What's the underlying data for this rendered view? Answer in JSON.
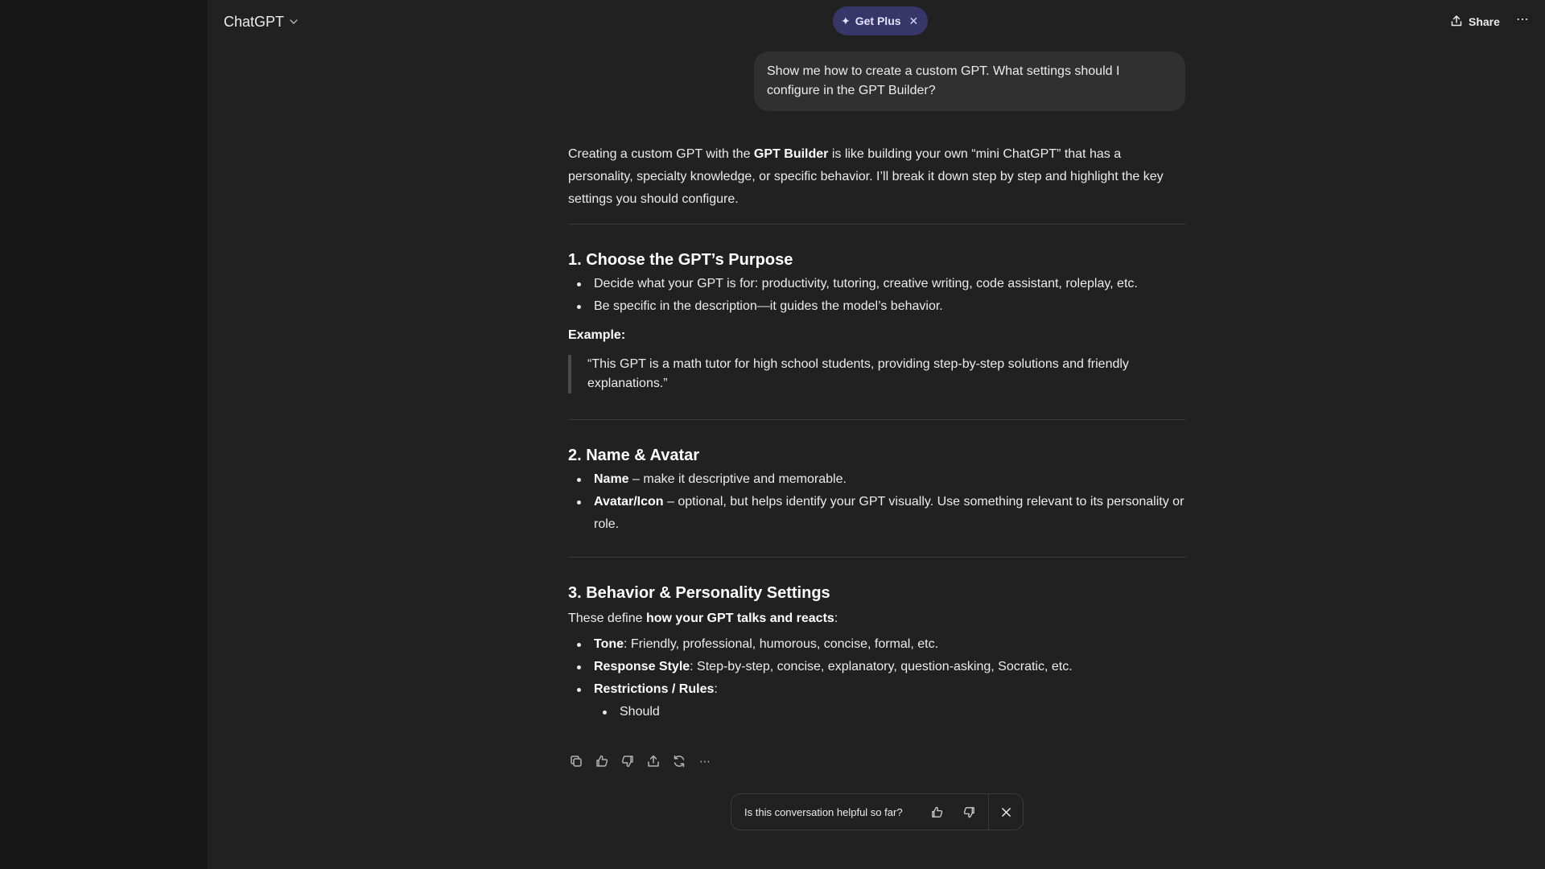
{
  "header": {
    "model_label": "ChatGPT",
    "getplus_label": "Get Plus",
    "share_label": "Share"
  },
  "conversation": {
    "user_message": "Show me how to create a custom GPT. What settings should I configure in the GPT Builder?",
    "intro": {
      "pre": "Creating a custom GPT with the ",
      "bold": "GPT Builder",
      "post": " is like building your own “mini ChatGPT” that has a personality, specialty knowledge, or specific behavior. I’ll break it down step by step and highlight the key settings you should configure."
    },
    "section1": {
      "heading": "1. Choose the GPT’s Purpose",
      "bullets": [
        "Decide what your GPT is for: productivity, tutoring, creative writing, code assistant, roleplay, etc.",
        "Be specific in the description—it guides the model’s behavior."
      ],
      "example_label": "Example:",
      "quote": "“This GPT is a math tutor for high school students, providing step-by-step solutions and friendly explanations.”"
    },
    "section2": {
      "heading": "2. Name & Avatar",
      "name_bold": "Name",
      "name_text": " – make it descriptive and memorable.",
      "avatar_bold": "Avatar/Icon",
      "avatar_text": " – optional, but helps identify your GPT visually. Use something relevant to its personality or role."
    },
    "section3": {
      "heading": "3. Behavior & Personality Settings",
      "intro_pre": "These define ",
      "intro_bold": "how your GPT talks and reacts",
      "intro_post": ":",
      "tone_bold": "Tone",
      "tone_text": ": Friendly, professional, humorous, concise, formal, etc.",
      "style_bold": "Response Style",
      "style_text": ": Step-by-step, concise, explanatory, question-asking, Socratic, etc.",
      "rules_bold": "Restrictions / Rules",
      "rules_text": ":",
      "sub_item": "Should"
    }
  },
  "feedback": {
    "question": "Is this conversation helpful so far?"
  },
  "icons": {
    "top": [
      "chevron-down-icon",
      "sparkle-icon",
      "close-icon",
      "share-icon",
      "more-icon"
    ],
    "actions": [
      "copy-icon",
      "thumbs-up-icon",
      "thumbs-down-icon",
      "share-icon",
      "regenerate-icon",
      "more-icon"
    ]
  },
  "colors": {
    "background": "#212121",
    "sidebar": "#171717",
    "user_bubble": "#303030",
    "getplus_bg": "#373669"
  }
}
